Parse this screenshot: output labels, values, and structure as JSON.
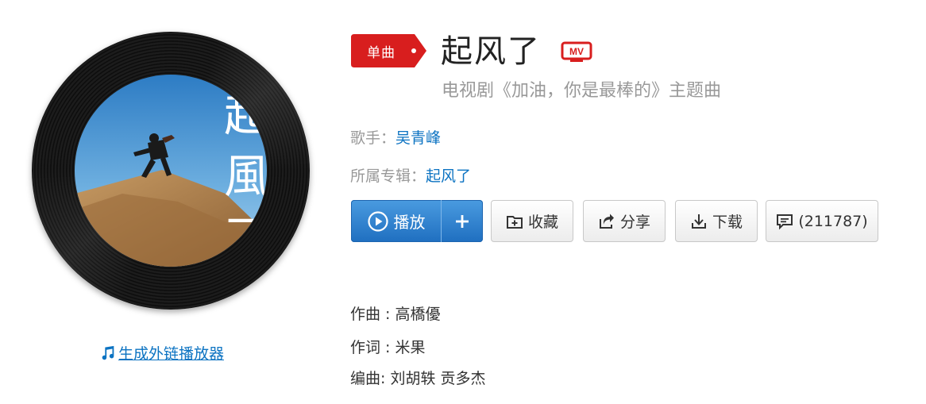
{
  "song": {
    "type_badge": "单曲",
    "title": "起风了",
    "mv_label": "MV",
    "subtitle": "电视剧《加油，你是最棒的》主题曲"
  },
  "meta": {
    "singer_label": "歌手：",
    "singer": "吴青峰",
    "album_label": "所属专辑：",
    "album": "起风了"
  },
  "buttons": {
    "play": "播放",
    "collect": "收藏",
    "share": "分享",
    "download": "下载",
    "comment": "(211787)"
  },
  "credits": {
    "composer": "作曲 : 高橋優",
    "lyricist": "作词 : 米果",
    "arranger": "编曲:  刘胡轶 贡多杰"
  },
  "player_link": "生成外链播放器",
  "cover": {
    "vertical_title": [
      "起",
      "風",
      "了"
    ],
    "sky_color": "#3f8fd0",
    "hill_color": "#b88a55"
  },
  "colors": {
    "link": "#0c73c2",
    "badge_red": "#d81e1e",
    "play_blue": "#2f7fd0"
  },
  "icons": {
    "badge": "dot-arrow-icon",
    "mv": "mv-icon",
    "play": "play-circle-icon",
    "add": "plus-icon",
    "collect": "folder-add-icon",
    "share": "share-icon",
    "download": "download-icon",
    "comment": "comment-icon",
    "link": "music-note-icon"
  }
}
